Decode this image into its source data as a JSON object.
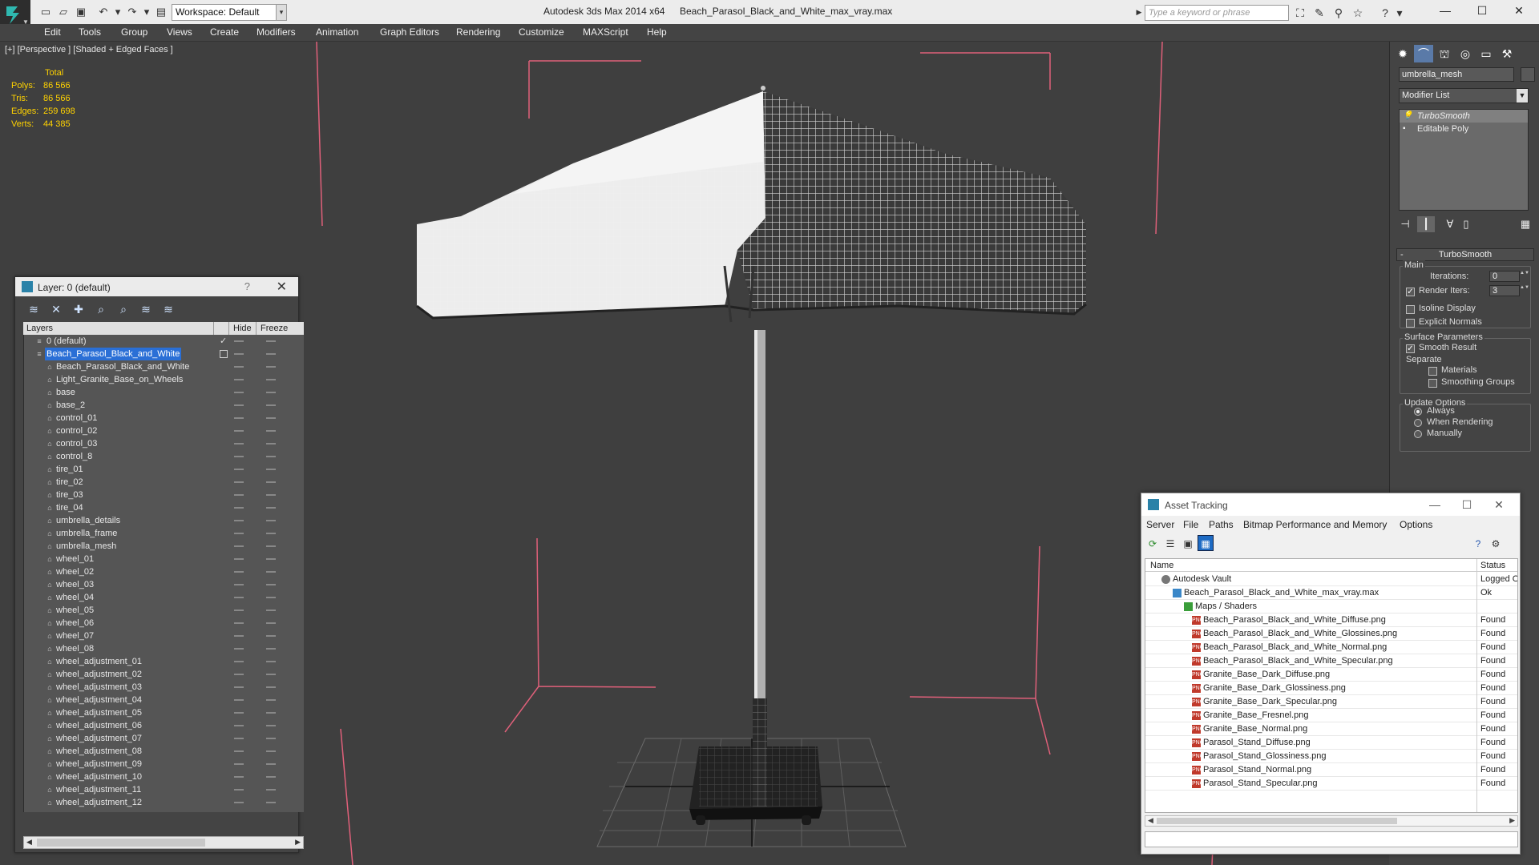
{
  "title_bar": {
    "workspace_label": "Workspace: Default",
    "app_title": "Autodesk 3ds Max  2014 x64",
    "file_title": "Beach_Parasol_Black_and_White_max_vray.max",
    "search_placeholder": "Type a keyword or phrase"
  },
  "menu": [
    "Edit",
    "Tools",
    "Group",
    "Views",
    "Create",
    "Modifiers",
    "Animation",
    "Graph Editors",
    "Rendering",
    "Customize",
    "MAXScript",
    "Help"
  ],
  "viewport": {
    "label": "[+] [Perspective ] [Shaded + Edged Faces ]",
    "stats": {
      "total_label": "Total",
      "rows": [
        {
          "key": "Polys:",
          "value": "86 566"
        },
        {
          "key": "Tris:",
          "value": "86 566"
        },
        {
          "key": "Edges:",
          "value": "259 698"
        },
        {
          "key": "Verts:",
          "value": "44 385"
        }
      ]
    }
  },
  "layer_panel": {
    "title": "Layer: 0 (default)",
    "help": "?",
    "columns": {
      "layers": "Layers",
      "hide": "Hide",
      "freeze": "Freeze"
    },
    "layers": [
      {
        "name": "0 (default)",
        "level": 0,
        "checked": true
      },
      {
        "name": "Beach_Parasol_Black_and_White",
        "level": 0,
        "selected": true
      },
      {
        "name": "Beach_Parasol_Black_and_White",
        "level": 1
      },
      {
        "name": "Light_Granite_Base_on_Wheels",
        "level": 1
      },
      {
        "name": "base",
        "level": 1
      },
      {
        "name": "base_2",
        "level": 1
      },
      {
        "name": "control_01",
        "level": 1
      },
      {
        "name": "control_02",
        "level": 1
      },
      {
        "name": "control_03",
        "level": 1
      },
      {
        "name": "control_8",
        "level": 1
      },
      {
        "name": "tire_01",
        "level": 1
      },
      {
        "name": "tire_02",
        "level": 1
      },
      {
        "name": "tire_03",
        "level": 1
      },
      {
        "name": "tire_04",
        "level": 1
      },
      {
        "name": "umbrella_details",
        "level": 1
      },
      {
        "name": "umbrella_frame",
        "level": 1
      },
      {
        "name": "umbrella_mesh",
        "level": 1
      },
      {
        "name": "wheel_01",
        "level": 1
      },
      {
        "name": "wheel_02",
        "level": 1
      },
      {
        "name": "wheel_03",
        "level": 1
      },
      {
        "name": "wheel_04",
        "level": 1
      },
      {
        "name": "wheel_05",
        "level": 1
      },
      {
        "name": "wheel_06",
        "level": 1
      },
      {
        "name": "wheel_07",
        "level": 1
      },
      {
        "name": "wheel_08",
        "level": 1
      },
      {
        "name": "wheel_adjustment_01",
        "level": 1
      },
      {
        "name": "wheel_adjustment_02",
        "level": 1
      },
      {
        "name": "wheel_adjustment_03",
        "level": 1
      },
      {
        "name": "wheel_adjustment_04",
        "level": 1
      },
      {
        "name": "wheel_adjustment_05",
        "level": 1
      },
      {
        "name": "wheel_adjustment_06",
        "level": 1
      },
      {
        "name": "wheel_adjustment_07",
        "level": 1
      },
      {
        "name": "wheel_adjustment_08",
        "level": 1
      },
      {
        "name": "wheel_adjustment_09",
        "level": 1
      },
      {
        "name": "wheel_adjustment_10",
        "level": 1
      },
      {
        "name": "wheel_adjustment_11",
        "level": 1
      },
      {
        "name": "wheel_adjustment_12",
        "level": 1
      }
    ]
  },
  "command_panel": {
    "object_name": "umbrella_mesh",
    "modifier_list": "Modifier List",
    "stack": [
      "TurboSmooth",
      "Editable Poly"
    ],
    "rollout_title": "TurboSmooth",
    "main_label": "Main",
    "iterations_label": "Iterations:",
    "iterations_value": "0",
    "render_iters_label": "Render Iters:",
    "render_iters_value": "3",
    "isoline_label": "Isoline Display",
    "explicit_label": "Explicit Normals",
    "surface_label": "Surface Parameters",
    "smooth_result_label": "Smooth Result",
    "separate_label": "Separate",
    "materials_label": "Materials",
    "smoothing_groups_label": "Smoothing Groups",
    "update_label": "Update Options",
    "always_label": "Always",
    "when_rendering_label": "When Rendering",
    "manually_label": "Manually"
  },
  "asset_tracking": {
    "title": "Asset Tracking",
    "menus": [
      "Server",
      "File",
      "Paths",
      "Bitmap Performance and Memory",
      "Options"
    ],
    "columns": {
      "name": "Name",
      "status": "Status"
    },
    "rows": [
      {
        "name": "Autodesk Vault",
        "status": "Logged Out",
        "level": 0,
        "icon": "vault"
      },
      {
        "name": "Beach_Parasol_Black_and_White_max_vray.max",
        "status": "Ok",
        "level": 1,
        "icon": "max"
      },
      {
        "name": "Maps / Shaders",
        "status": "",
        "level": 2,
        "icon": "folder"
      },
      {
        "name": "Beach_Parasol_Black_and_White_Diffuse.png",
        "status": "Found",
        "level": 3,
        "icon": "png"
      },
      {
        "name": "Beach_Parasol_Black_and_White_Glossines.png",
        "status": "Found",
        "level": 3,
        "icon": "png"
      },
      {
        "name": "Beach_Parasol_Black_and_White_Normal.png",
        "status": "Found",
        "level": 3,
        "icon": "png"
      },
      {
        "name": "Beach_Parasol_Black_and_White_Specular.png",
        "status": "Found",
        "level": 3,
        "icon": "png"
      },
      {
        "name": "Granite_Base_Dark_Diffuse.png",
        "status": "Found",
        "level": 3,
        "icon": "png"
      },
      {
        "name": "Granite_Base_Dark_Glossiness.png",
        "status": "Found",
        "level": 3,
        "icon": "png"
      },
      {
        "name": "Granite_Base_Dark_Specular.png",
        "status": "Found",
        "level": 3,
        "icon": "png"
      },
      {
        "name": "Granite_Base_Fresnel.png",
        "status": "Found",
        "level": 3,
        "icon": "png"
      },
      {
        "name": "Granite_Base_Normal.png",
        "status": "Found",
        "level": 3,
        "icon": "png"
      },
      {
        "name": "Parasol_Stand_Diffuse.png",
        "status": "Found",
        "level": 3,
        "icon": "png"
      },
      {
        "name": "Parasol_Stand_Glossiness.png",
        "status": "Found",
        "level": 3,
        "icon": "png"
      },
      {
        "name": "Parasol_Stand_Normal.png",
        "status": "Found",
        "level": 3,
        "icon": "png"
      },
      {
        "name": "Parasol_Stand_Specular.png",
        "status": "Found",
        "level": 3,
        "icon": "png"
      }
    ]
  },
  "colors": {
    "selection_blue": "#2a6fd6",
    "stats_yellow": "#ffd200",
    "bracket_pink": "#e0607a"
  }
}
